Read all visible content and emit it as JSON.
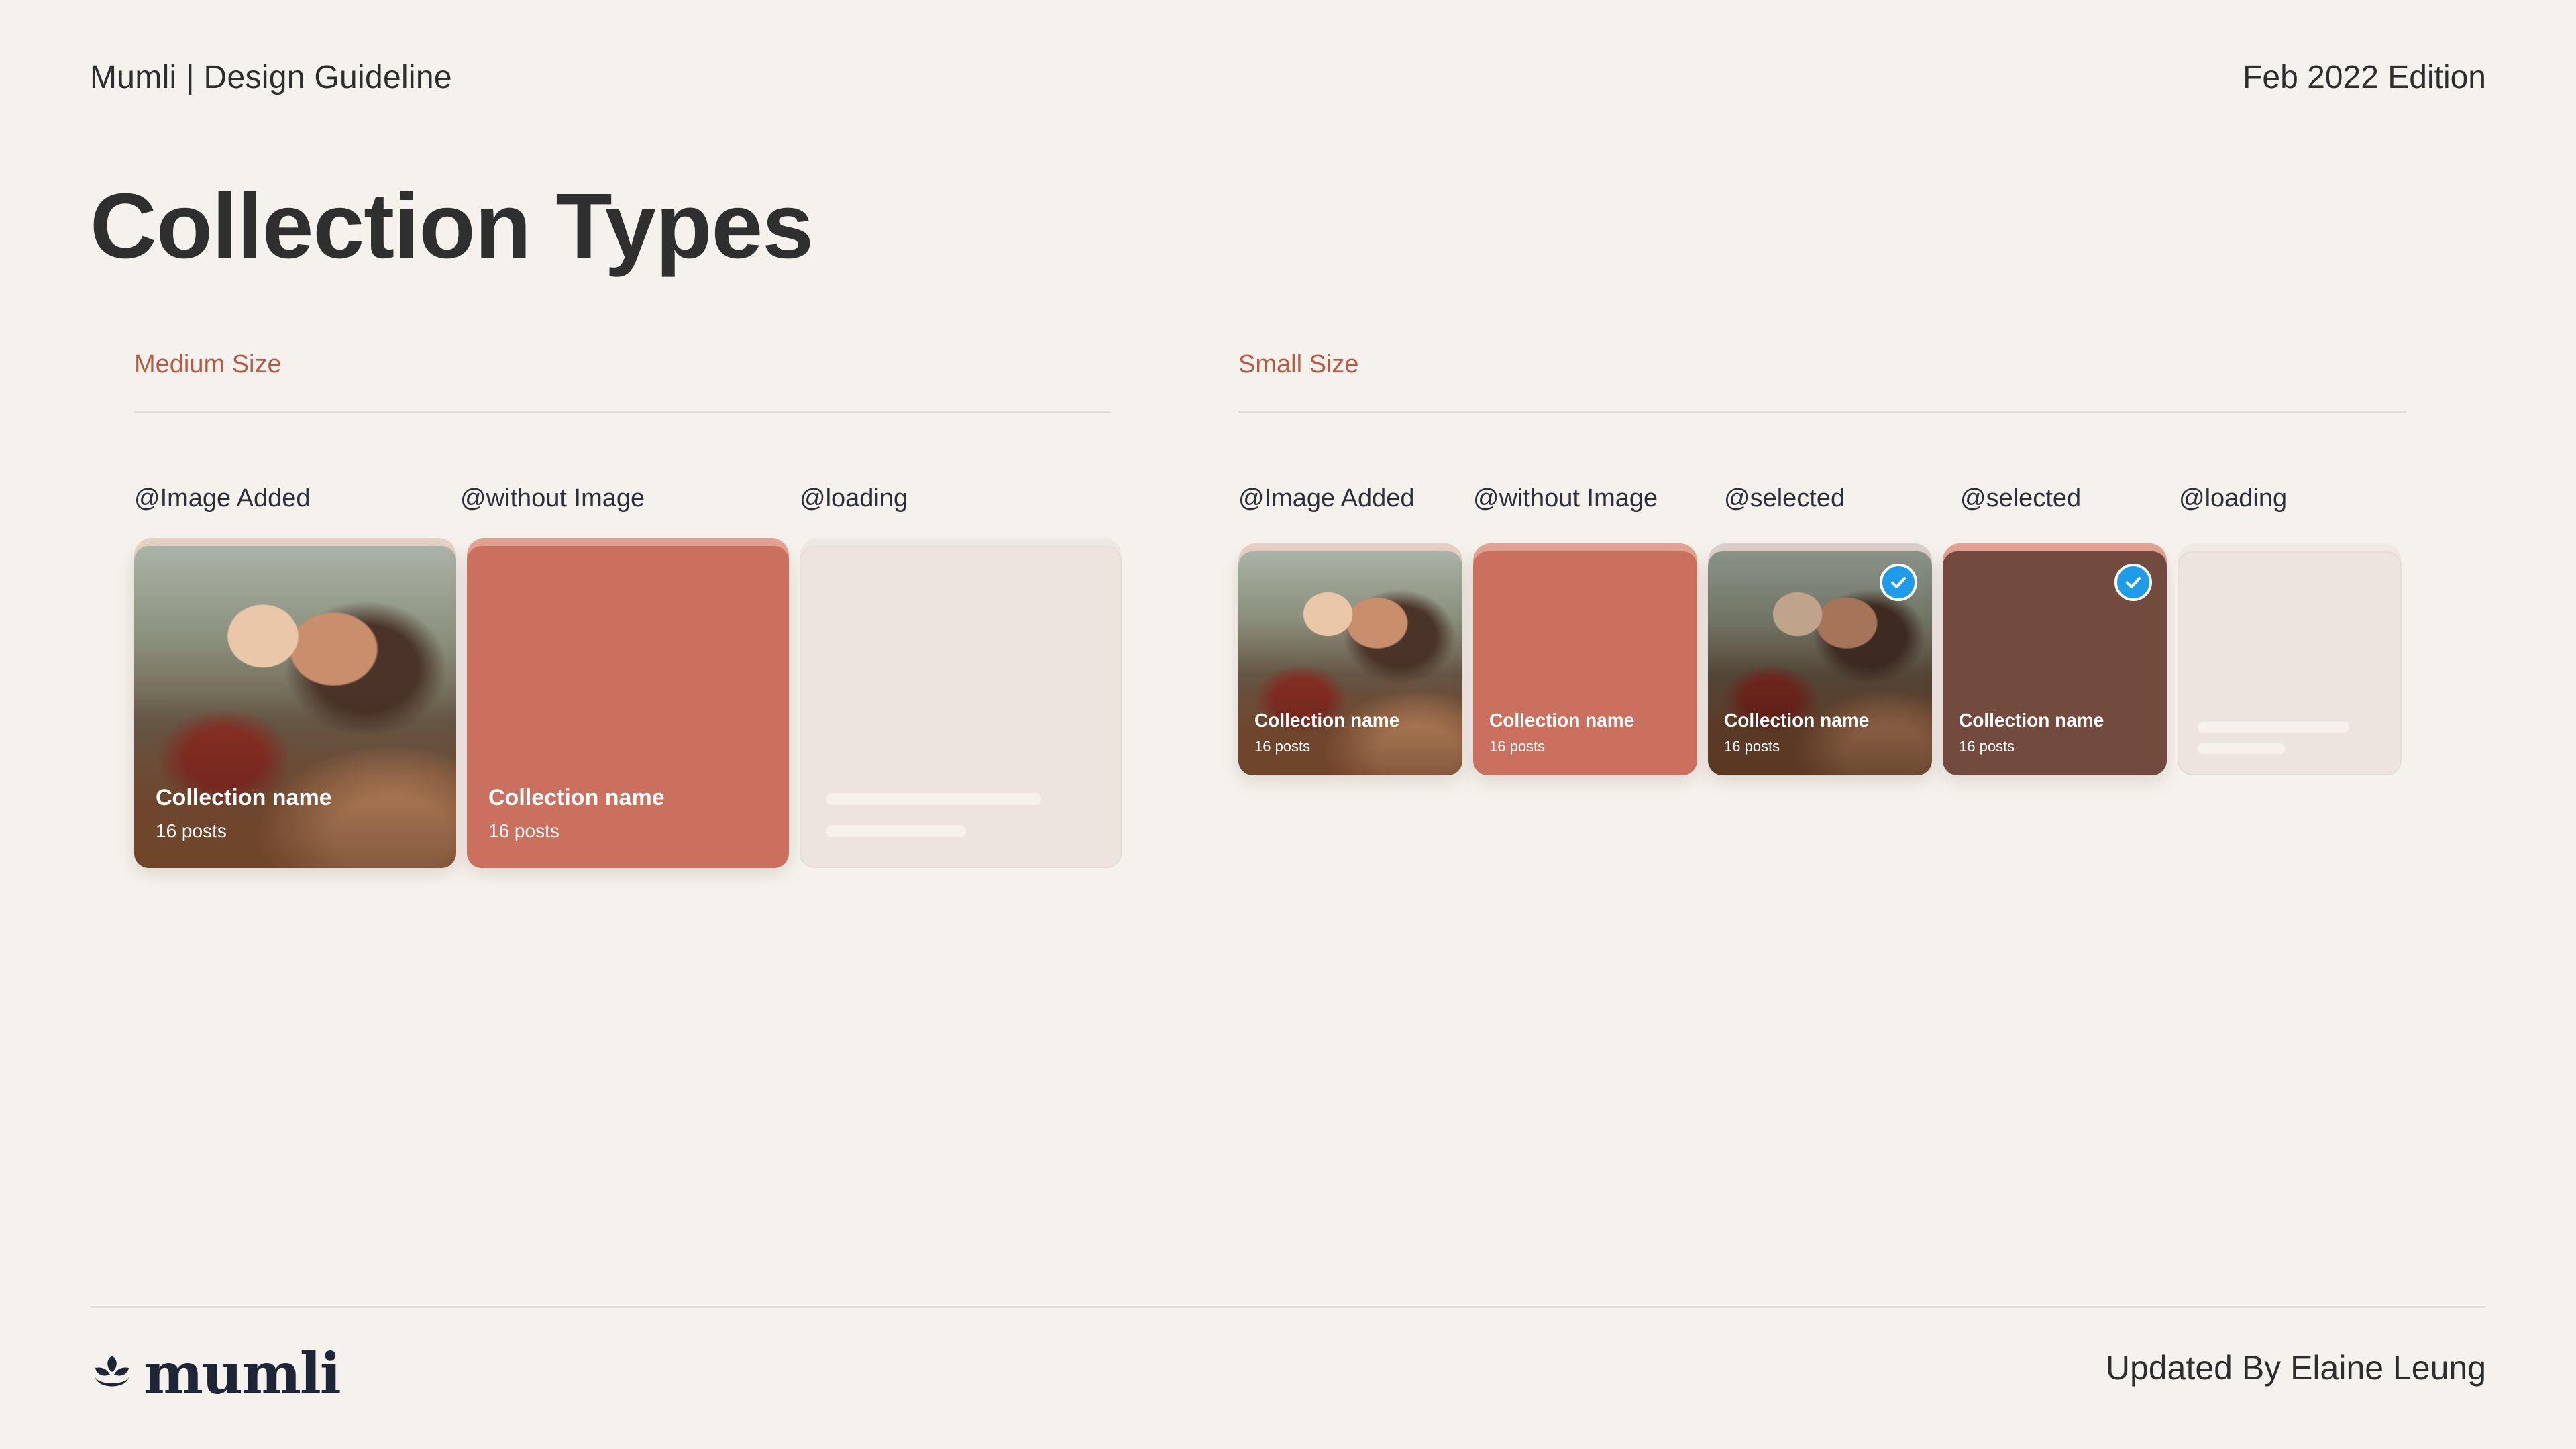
{
  "header": {
    "left": "Mumli | Design Guideline",
    "right": "Feb 2022 Edition"
  },
  "page_title": "Collection Types",
  "sections": {
    "medium": {
      "title": "Medium Size",
      "labels": [
        "@Image Added",
        "@without Image",
        "@loading"
      ],
      "cards": [
        {
          "name": "Collection name",
          "posts": "16 posts"
        },
        {
          "name": "Collection name",
          "posts": "16 posts"
        }
      ]
    },
    "small": {
      "title": "Small Size",
      "labels": [
        "@Image Added",
        "@without Image",
        "@selected",
        "@selected",
        "@loading"
      ],
      "cards": [
        {
          "name": "Collection name",
          "posts": "16 posts"
        },
        {
          "name": "Collection name",
          "posts": "16 posts"
        },
        {
          "name": "Collection name",
          "posts": "16 posts"
        },
        {
          "name": "Collection name",
          "posts": "16 posts"
        }
      ]
    }
  },
  "footer": {
    "logo_text": "mumli",
    "right": "Updated By Elaine Leung"
  },
  "colors": {
    "background": "#f5f2ed",
    "accent": "#b65a45",
    "coral": "#cb705e",
    "brown": "#724a3e",
    "loading": "#ece5df",
    "check": "#1e9be9"
  }
}
